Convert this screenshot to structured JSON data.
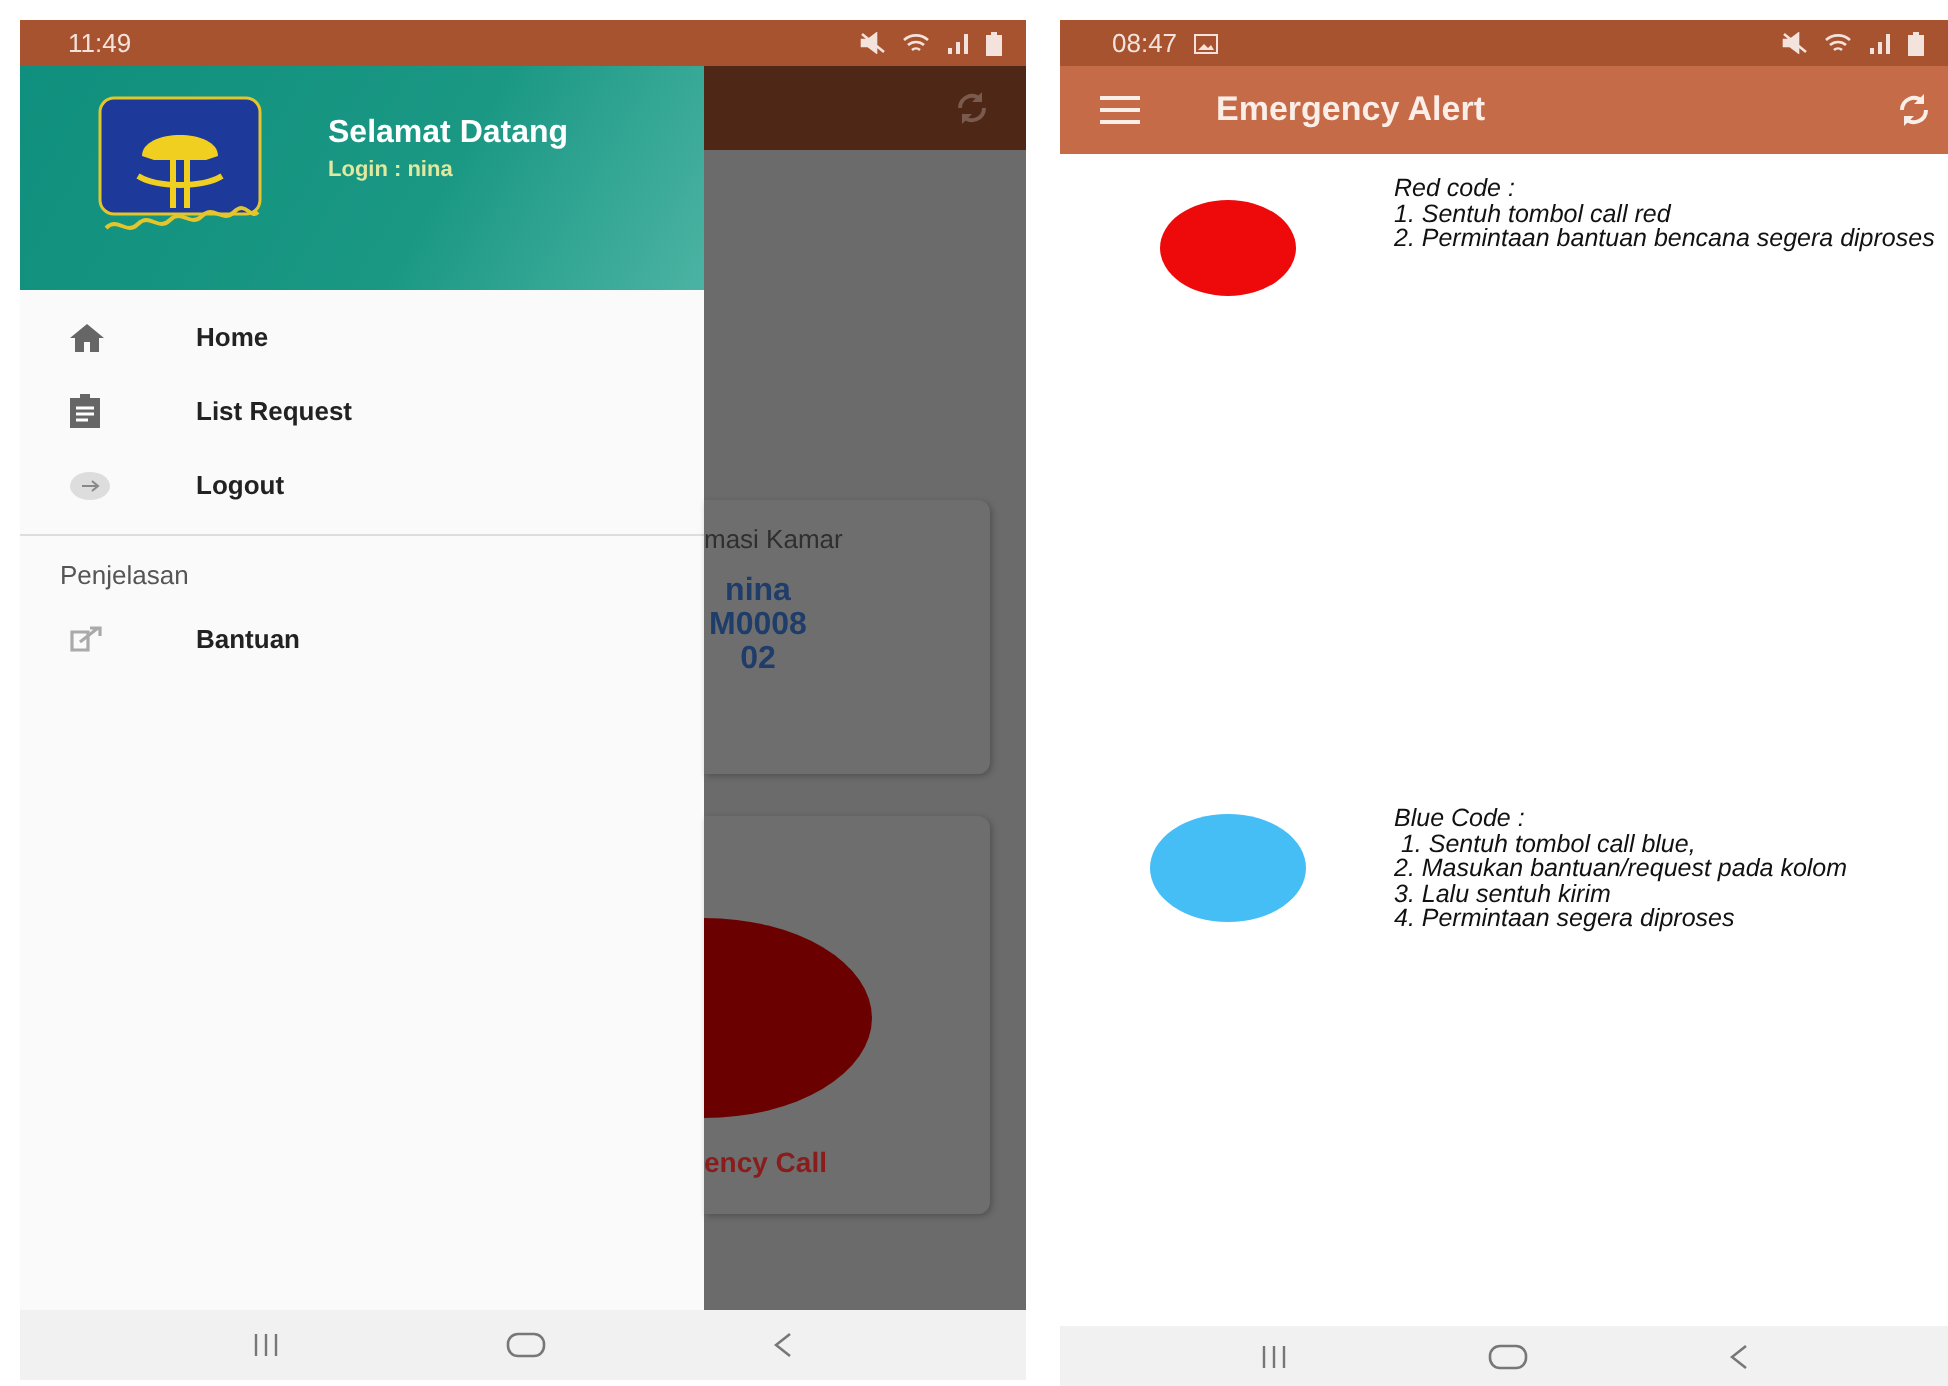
{
  "phones": [
    {
      "kind": "drawer",
      "status_bar": {
        "time": "11:49"
      },
      "drawer": {
        "title": "Selamat Datang",
        "subtitle": "Login :  nina",
        "items": [
          {
            "kind": "home",
            "label": "Home"
          },
          {
            "kind": "list",
            "label": "List Request"
          },
          {
            "kind": "logout",
            "label": "Logout"
          }
        ],
        "section": "Penjelasan",
        "section_items": [
          {
            "kind": "help",
            "label": "Bantuan"
          }
        ]
      },
      "background": {
        "card_title": "masi Kamar",
        "card_lines": [
          "nina",
          "M0008",
          "02"
        ],
        "call_label": "ency Call"
      }
    },
    {
      "kind": "alert",
      "status_bar": {
        "time": "08:47"
      },
      "app_bar": {
        "title": "Emergency Alert"
      },
      "codes": [
        {
          "color": "#ee0a0a",
          "lines": [
            "Red code :",
            "1. Sentuh tombol call red",
            "2. Permintaan bantuan bencana segera diproses"
          ]
        },
        {
          "color": "#45bdf5",
          "lines": [
            "Blue Code :",
            " 1. Sentuh tombol call blue,",
            "2. Masukan bantuan/request pada kolom",
            "3. Lalu sentuh kirim",
            "4. Permintaan segera diproses"
          ]
        }
      ]
    }
  ]
}
